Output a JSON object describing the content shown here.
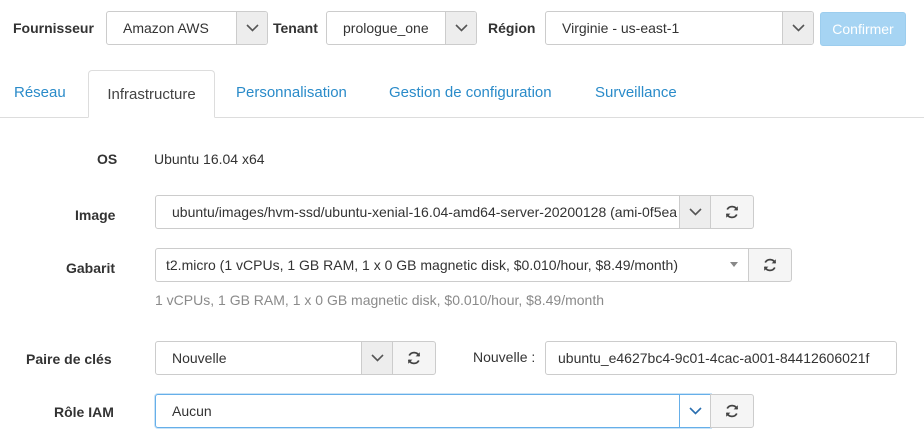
{
  "filters": {
    "provider": {
      "label": "Fournisseur",
      "value": "Amazon AWS"
    },
    "tenant": {
      "label": "Tenant",
      "value": "prologue_one"
    },
    "region": {
      "label": "Région",
      "value": "Virginie - us-east-1"
    },
    "confirm_label": "Confirmer"
  },
  "tabs": [
    {
      "label": "Réseau",
      "active": false
    },
    {
      "label": "Infrastructure",
      "active": true
    },
    {
      "label": "Personnalisation",
      "active": false
    },
    {
      "label": "Gestion de configuration",
      "active": false
    },
    {
      "label": "Surveillance",
      "active": false
    }
  ],
  "form": {
    "os": {
      "label": "OS",
      "value": "Ubuntu 16.04 x64"
    },
    "image": {
      "label": "Image",
      "value": "ubuntu/images/hvm-ssd/ubuntu-xenial-16.04-amd64-server-20200128 (ami-0f5ea"
    },
    "gabarit": {
      "label": "Gabarit",
      "value": "t2.micro (1 vCPUs, 1 GB RAM, 1 x 0 GB magnetic disk, $0.010/hour, $8.49/month)",
      "help": "1 vCPUs, 1 GB RAM, 1 x 0 GB magnetic disk, $0.010/hour, $8.49/month"
    },
    "keypair": {
      "label": "Paire de clés",
      "value": "Nouvelle",
      "new_label": "Nouvelle :",
      "new_value": "ubuntu_e4627bc4-9c01-4cac-a001-84412606021f"
    },
    "iam": {
      "label": "Rôle IAM",
      "value": "Aucun"
    }
  },
  "colors": {
    "link": "#2a8bc9",
    "confirm_bg": "#a6d4f3",
    "focus_border": "#66afe9",
    "help_text": "#8a8a8a"
  },
  "icons": {
    "caret": "chevron-down-icon",
    "refresh": "refresh-icon"
  }
}
